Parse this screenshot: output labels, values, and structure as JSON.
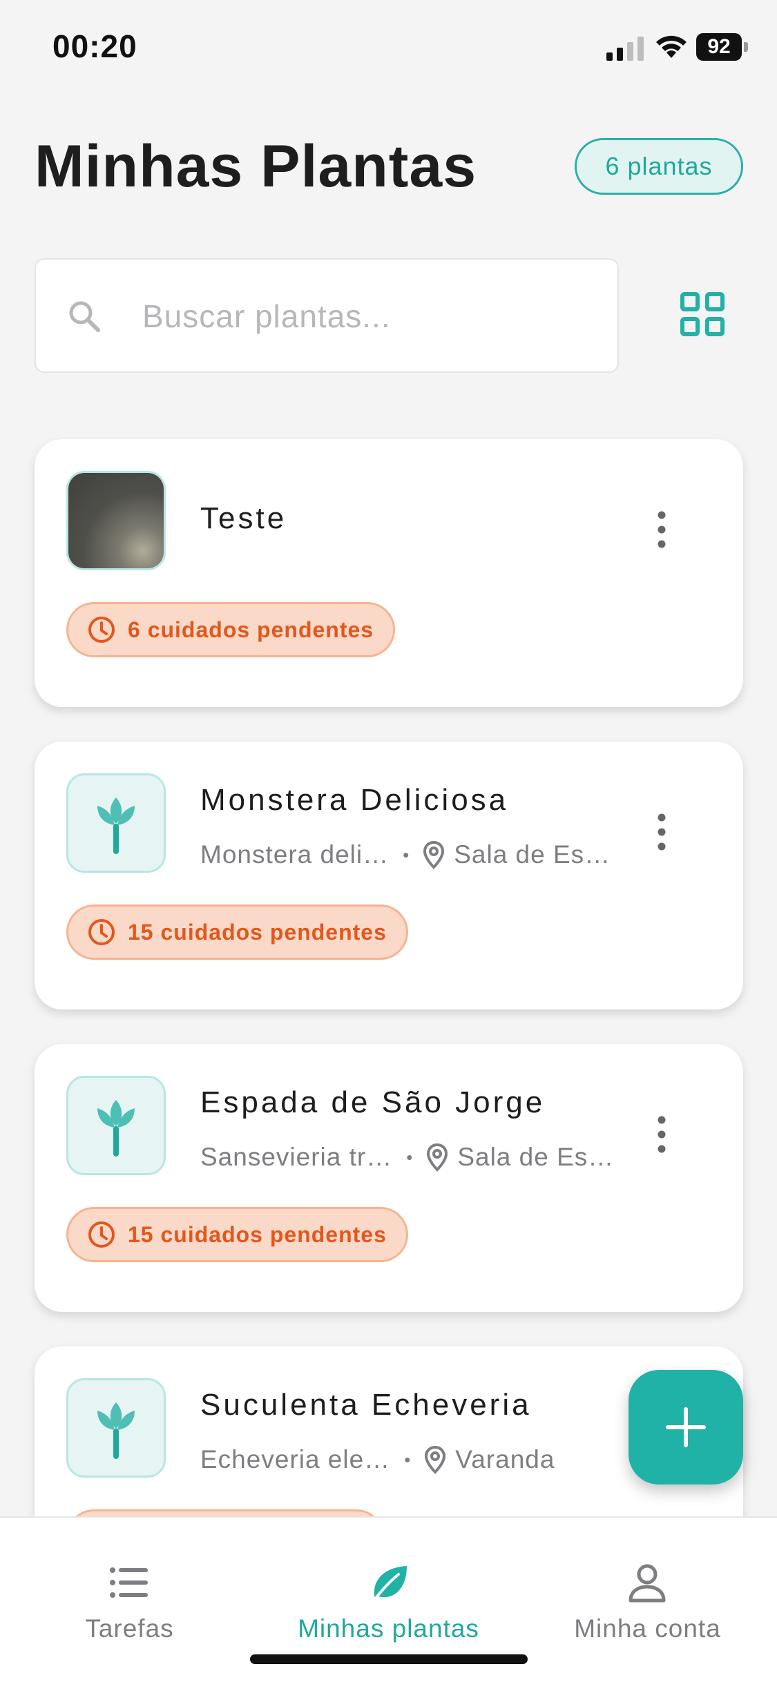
{
  "status_bar": {
    "time": "00:20",
    "battery": "92"
  },
  "header": {
    "title": "Minhas Plantas",
    "count_badge": "6 plantas"
  },
  "search": {
    "placeholder": "Buscar plantas..."
  },
  "plants": [
    {
      "name": "Teste",
      "scientific": "",
      "location": "",
      "care": "6 cuidados pendentes",
      "thumb": "photo"
    },
    {
      "name": "Monstera Deliciosa",
      "scientific": "Monstera deli…",
      "location": "Sala de Es…",
      "care": "15 cuidados pendentes",
      "thumb": "plant-icon"
    },
    {
      "name": "Espada de São Jorge",
      "scientific": "Sansevieria tr…",
      "location": "Sala de Es…",
      "care": "15 cuidados pendentes",
      "thumb": "plant-icon"
    },
    {
      "name": "Suculenta Echeveria",
      "scientific": "Echeveria ele…",
      "location": "Varanda",
      "care": "",
      "thumb": "plant-icon"
    }
  ],
  "nav": {
    "tasks": "Tarefas",
    "plants": "Minhas plantas",
    "account": "Minha conta"
  },
  "colors": {
    "accent": "#21b2a7",
    "care_text": "#e2571c",
    "care_bg": "#fbd9c9"
  }
}
